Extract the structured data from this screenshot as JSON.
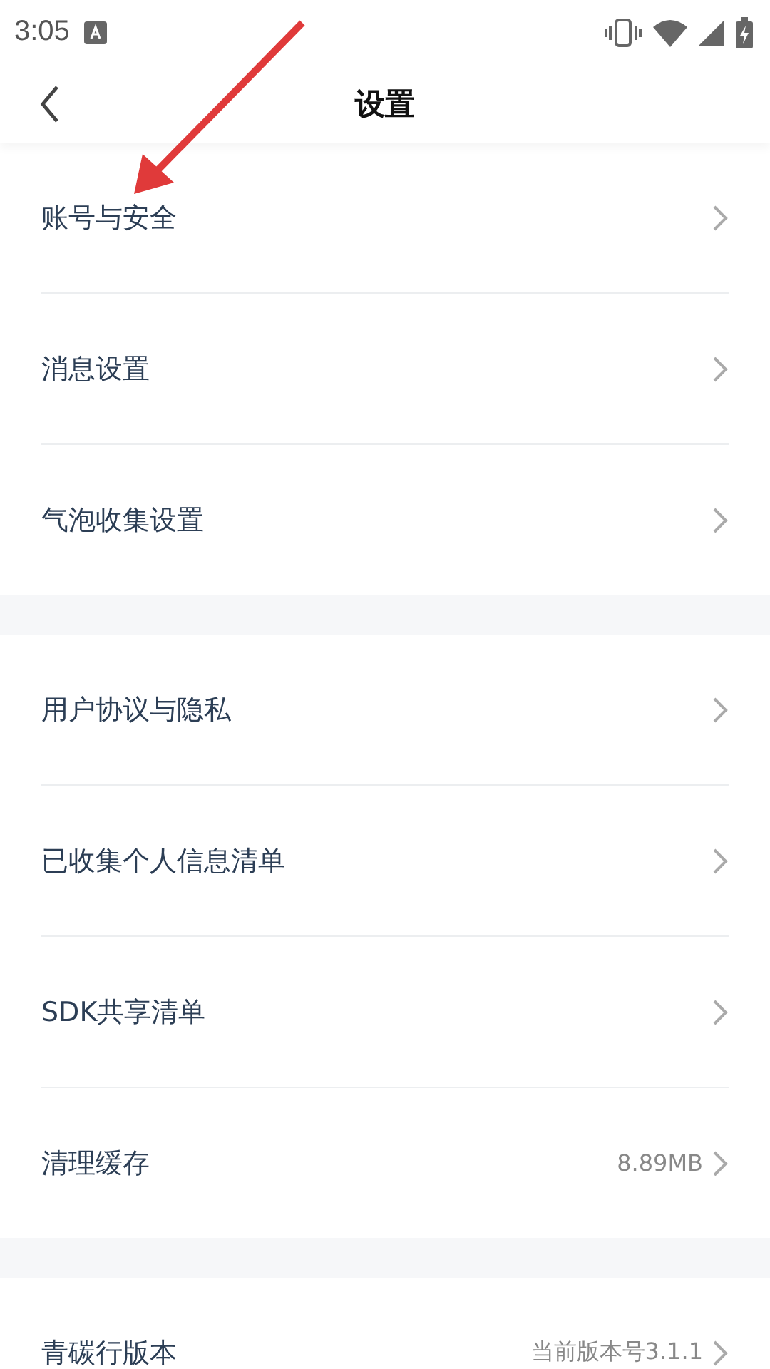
{
  "status_bar": {
    "time": "3:05"
  },
  "header": {
    "title": "设置"
  },
  "groups": [
    {
      "items": [
        {
          "label": "账号与安全"
        },
        {
          "label": "消息设置"
        },
        {
          "label": "气泡收集设置"
        }
      ]
    },
    {
      "items": [
        {
          "label": "用户协议与隐私"
        },
        {
          "label": "已收集个人信息清单"
        },
        {
          "label": "SDK共享清单"
        },
        {
          "label": "清理缓存",
          "value": "8.89MB"
        }
      ]
    },
    {
      "items": [
        {
          "label": "青碳行版本",
          "value": "当前版本号3.1.1"
        }
      ]
    }
  ]
}
